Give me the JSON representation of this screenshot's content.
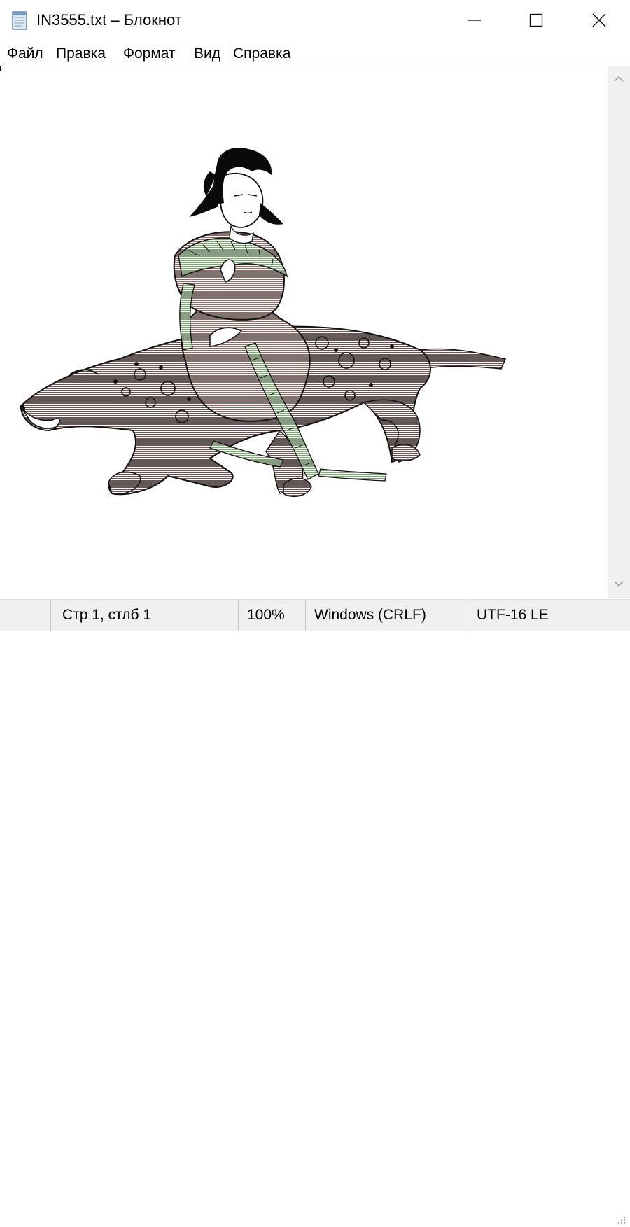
{
  "window": {
    "title": "IN3555.txt – Блокнот"
  },
  "icons": {
    "app": "notepad-icon",
    "minimize": "minimize-icon",
    "maximize": "maximize-icon",
    "close": "close-icon",
    "scroll_up": "chevron-up-icon",
    "scroll_down": "chevron-down-icon",
    "grip": "resize-grip-icon"
  },
  "menu": {
    "items": [
      "Файл",
      "Правка",
      "Формат",
      "Вид",
      "Справка"
    ]
  },
  "statusbar": {
    "position": "Стр 1, стлб 1",
    "zoom": "100%",
    "line_ending": "Windows (CRLF)",
    "encoding": "UTF-16 LE"
  },
  "colors": {
    "beast_body": "#6b5552",
    "robe": "#8b6d6a",
    "leaves": "#7fa577",
    "hair": "#0a0a0a",
    "chrome_bg": "#f0f0f0"
  }
}
